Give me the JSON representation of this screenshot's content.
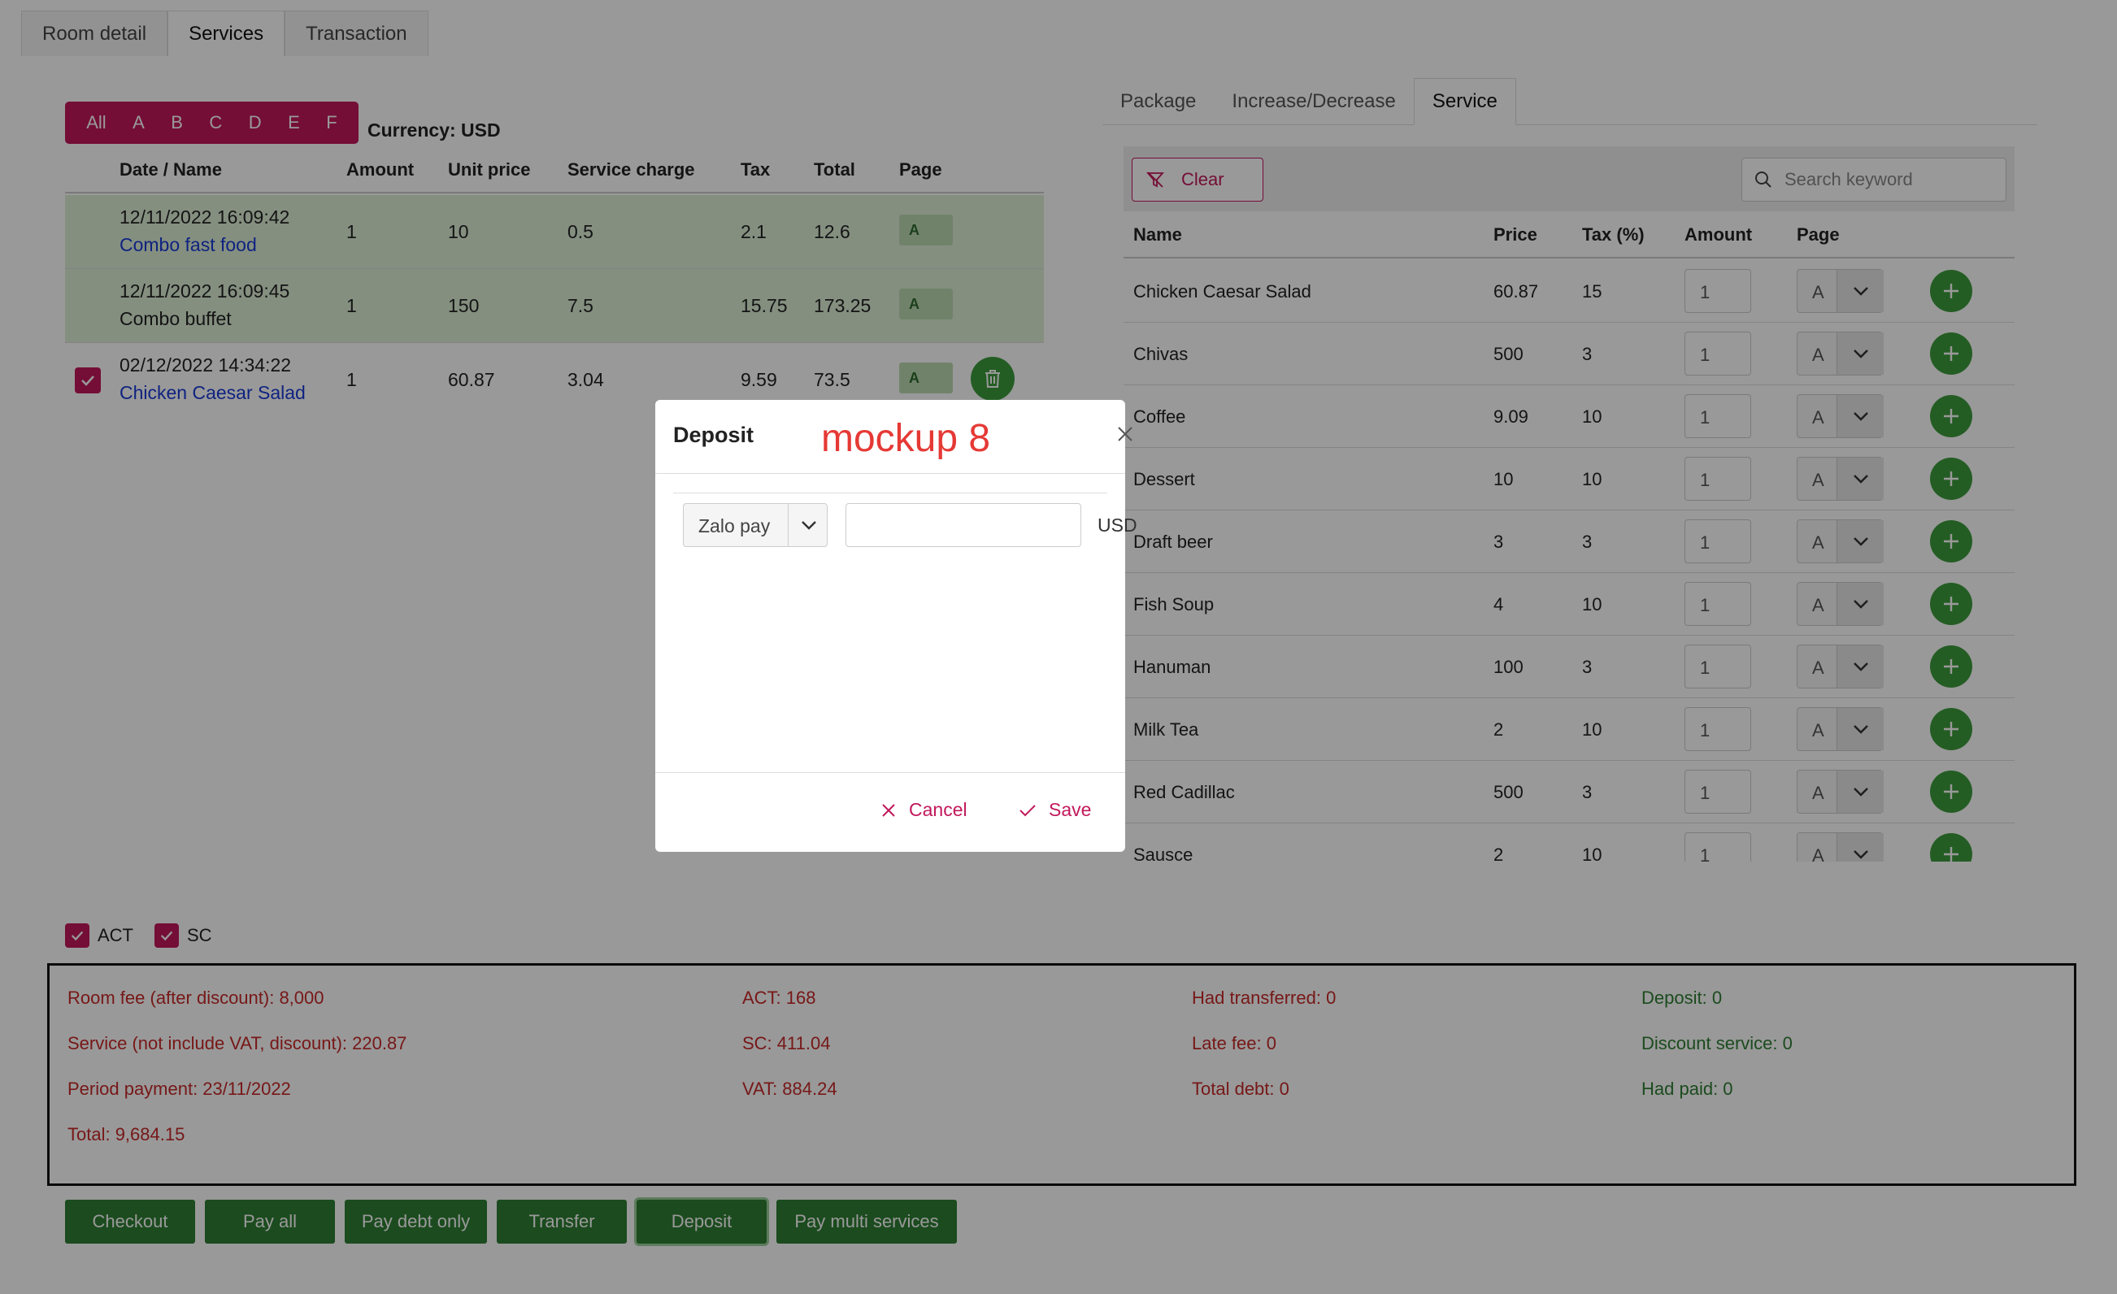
{
  "top_tabs": [
    "Room detail",
    "Services",
    "Transaction"
  ],
  "page_filter": {
    "letters": [
      "All",
      "A",
      "B",
      "C",
      "D",
      "E",
      "F"
    ],
    "currency": "Currency: USD"
  },
  "left_table": {
    "headers": [
      "Date / Name",
      "Amount",
      "Unit price",
      "Service charge",
      "Tax",
      "Total",
      "Page"
    ],
    "rows": [
      {
        "date": "12/11/2022 16:09:42",
        "name": "Combo fast food",
        "amount": "1",
        "unit_price": "10",
        "service_charge": "0.5",
        "tax": "2.1",
        "total": "12.6",
        "page": "A"
      },
      {
        "date": "12/11/2022 16:09:45",
        "name": "Combo buffet",
        "amount": "1",
        "unit_price": "150",
        "service_charge": "7.5",
        "tax": "15.75",
        "total": "173.25",
        "page": "A"
      },
      {
        "date": "02/12/2022 14:34:22",
        "name": "Chicken Caesar Salad",
        "amount": "1",
        "unit_price": "60.87",
        "service_charge": "3.04",
        "tax": "9.59",
        "total": "73.5",
        "page": "A"
      }
    ]
  },
  "right_tabs": [
    "Package",
    "Increase/Decrease",
    "Service"
  ],
  "toolbar": {
    "clear_label": "Clear",
    "search_placeholder": "Search keyword"
  },
  "service_table": {
    "headers": [
      "Name",
      "Price",
      "Tax (%)",
      "Amount",
      "Page"
    ],
    "rows": [
      {
        "name": "Chicken Caesar Salad",
        "price": "60.87",
        "tax": "15",
        "amount": "1",
        "page": "A"
      },
      {
        "name": "Chivas",
        "price": "500",
        "tax": "3",
        "amount": "1",
        "page": "A"
      },
      {
        "name": "Coffee",
        "price": "9.09",
        "tax": "10",
        "amount": "1",
        "page": "A"
      },
      {
        "name": "Dessert",
        "price": "10",
        "tax": "10",
        "amount": "1",
        "page": "A"
      },
      {
        "name": "Draft beer",
        "price": "3",
        "tax": "3",
        "amount": "1",
        "page": "A"
      },
      {
        "name": "Fish Soup",
        "price": "4",
        "tax": "10",
        "amount": "1",
        "page": "A"
      },
      {
        "name": "Hanuman",
        "price": "100",
        "tax": "3",
        "amount": "1",
        "page": "A"
      },
      {
        "name": "Milk Tea",
        "price": "2",
        "tax": "10",
        "amount": "1",
        "page": "A"
      },
      {
        "name": "Red Cadillac",
        "price": "500",
        "tax": "3",
        "amount": "1",
        "page": "A"
      },
      {
        "name": "Sausce",
        "price": "2",
        "tax": "10",
        "amount": "1",
        "page": "A"
      }
    ]
  },
  "checkboxes": {
    "act": "ACT",
    "sc": "SC"
  },
  "summary": {
    "room_fee": "Room fee (after discount): 8,000",
    "service": "Service (not include VAT, discount): 220.87",
    "period": "Period payment: 23/11/2022",
    "total": "Total: 9,684.15",
    "act": "ACT: 168",
    "sc": "SC: 411.04",
    "vat": "VAT: 884.24",
    "transferred": "Had transferred: 0",
    "late_fee": "Late fee: 0",
    "total_debt": "Total debt: 0",
    "deposit": "Deposit: 0",
    "discount_service": "Discount service: 0",
    "had_paid": "Had paid: 0"
  },
  "actions": [
    "Checkout",
    "Pay all",
    "Pay debt only",
    "Transfer",
    "Deposit",
    "Pay multi services"
  ],
  "modal": {
    "title": "Deposit",
    "mockup_label": "mockup 8",
    "method": "Zalo pay",
    "amount": "",
    "currency": "USD",
    "cancel": "Cancel",
    "save": "Save"
  },
  "colors": {
    "accent": "#c2185b",
    "green": "#2e7d32",
    "summary_red": "#c62828"
  }
}
